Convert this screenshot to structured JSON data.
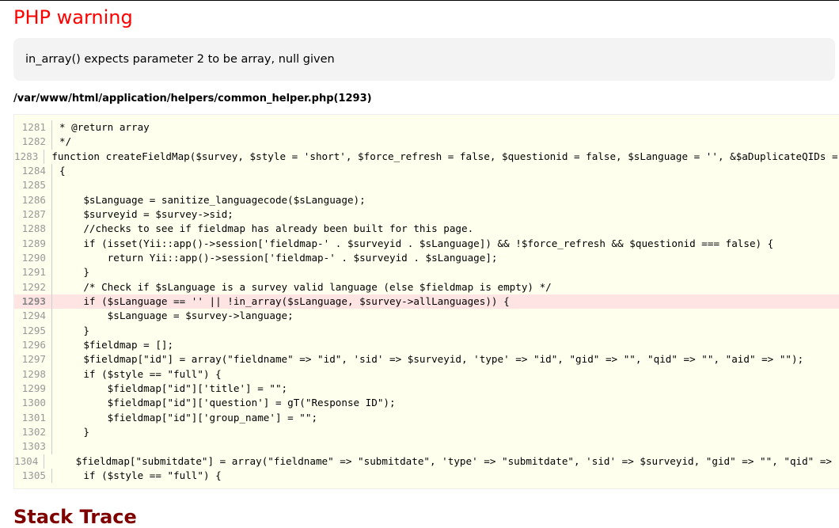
{
  "title": "PHP warning",
  "message": "in_array() expects parameter 2 to be array, null given",
  "file_path": "/var/www/html/application/helpers/common_helper.php(1293)",
  "highlight_line": 1293,
  "colors": {
    "title": "#ff0000",
    "highlight": "#ffe4e4",
    "code_bg": "#ffffee",
    "stack_title": "#800000"
  },
  "code_lines": [
    {
      "n": "1281",
      "t": "* @return array"
    },
    {
      "n": "1282",
      "t": "*/"
    },
    {
      "n": "1283",
      "t": "function createFieldMap($survey, $style = 'short', $force_refresh = false, $questionid = false, $sLanguage = '', &$aDuplicateQIDs = array())"
    },
    {
      "n": "1284",
      "t": "{"
    },
    {
      "n": "1285",
      "t": ""
    },
    {
      "n": "1286",
      "t": "    $sLanguage = sanitize_languagecode($sLanguage);"
    },
    {
      "n": "1287",
      "t": "    $surveyid = $survey->sid;"
    },
    {
      "n": "1288",
      "t": "    //checks to see if fieldmap has already been built for this page."
    },
    {
      "n": "1289",
      "t": "    if (isset(Yii::app()->session['fieldmap-' . $surveyid . $sLanguage]) && !$force_refresh && $questionid === false) {"
    },
    {
      "n": "1290",
      "t": "        return Yii::app()->session['fieldmap-' . $surveyid . $sLanguage];"
    },
    {
      "n": "1291",
      "t": "    }"
    },
    {
      "n": "1292",
      "t": "    /* Check if $sLanguage is a survey valid language (else $fieldmap is empty) */"
    },
    {
      "n": "1293",
      "t": "    if ($sLanguage == '' || !in_array($sLanguage, $survey->allLanguages)) {"
    },
    {
      "n": "1294",
      "t": "        $sLanguage = $survey->language;"
    },
    {
      "n": "1295",
      "t": "    }"
    },
    {
      "n": "1296",
      "t": "    $fieldmap = [];"
    },
    {
      "n": "1297",
      "t": "    $fieldmap[\"id\"] = array(\"fieldname\" => \"id\", 'sid' => $surveyid, 'type' => \"id\", \"gid\" => \"\", \"qid\" => \"\", \"aid\" => \"\");"
    },
    {
      "n": "1298",
      "t": "    if ($style == \"full\") {"
    },
    {
      "n": "1299",
      "t": "        $fieldmap[\"id\"]['title'] = \"\";"
    },
    {
      "n": "1300",
      "t": "        $fieldmap[\"id\"]['question'] = gT(\"Response ID\");"
    },
    {
      "n": "1301",
      "t": "        $fieldmap[\"id\"]['group_name'] = \"\";"
    },
    {
      "n": "1302",
      "t": "    }"
    },
    {
      "n": "1303",
      "t": ""
    },
    {
      "n": "1304",
      "t": "    $fieldmap[\"submitdate\"] = array(\"fieldname\" => \"submitdate\", 'type' => \"submitdate\", 'sid' => $surveyid, \"gid\" => \"\", \"qid\" => \"\", \"aid\" => \"\");"
    },
    {
      "n": "1305",
      "t": "    if ($style == \"full\") {"
    }
  ],
  "stack_title": "Stack Trace"
}
